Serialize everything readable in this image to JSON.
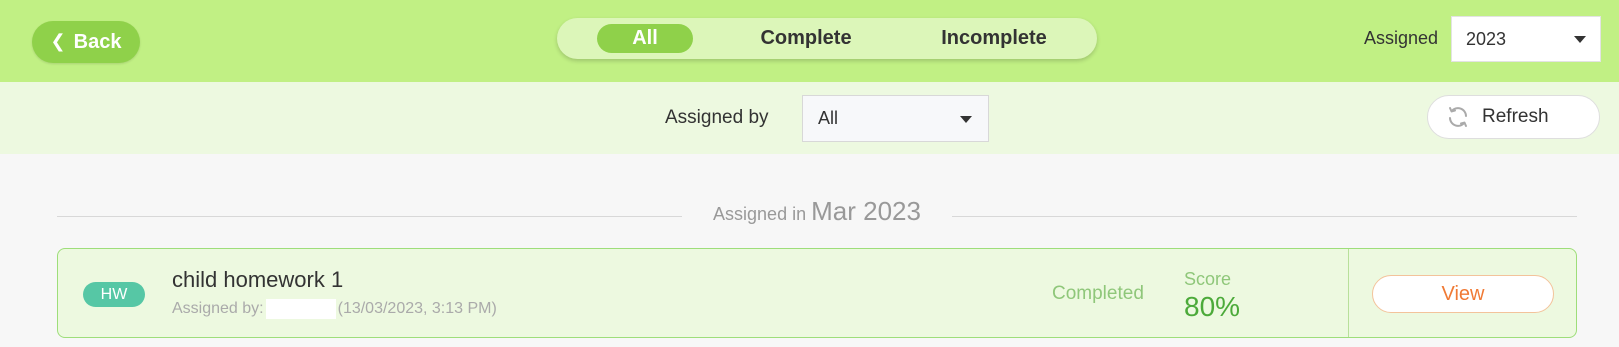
{
  "header": {
    "back_label": "Back",
    "tabs": [
      {
        "label": "All",
        "active": true
      },
      {
        "label": "Complete",
        "active": false
      },
      {
        "label": "Incomplete",
        "active": false
      }
    ],
    "assigned_label": "Assigned",
    "year_value": "2023"
  },
  "filter": {
    "assigned_by_label": "Assigned by",
    "assigned_by_value": "All",
    "refresh_label": "Refresh"
  },
  "group": {
    "prefix": "Assigned in",
    "month": "Mar 2023"
  },
  "homework": [
    {
      "badge": "HW",
      "title": "child homework 1",
      "assigned_by_prefix": "Assigned by:",
      "assigned_meta": "(13/03/2023, 3:13 PM)",
      "status": "Completed",
      "score_label": "Score",
      "score_value": "80%",
      "view_label": "View"
    }
  ],
  "colors": {
    "topbar": "#c1f084",
    "accent_green": "#8fd14a",
    "filterbar": "#edf9e0",
    "badge": "#56c7a5",
    "score": "#4caa3a",
    "view": "#f07a35"
  },
  "icons": {
    "back": "chevron-left-icon",
    "select": "caret-down-icon",
    "refresh": "refresh-icon"
  }
}
